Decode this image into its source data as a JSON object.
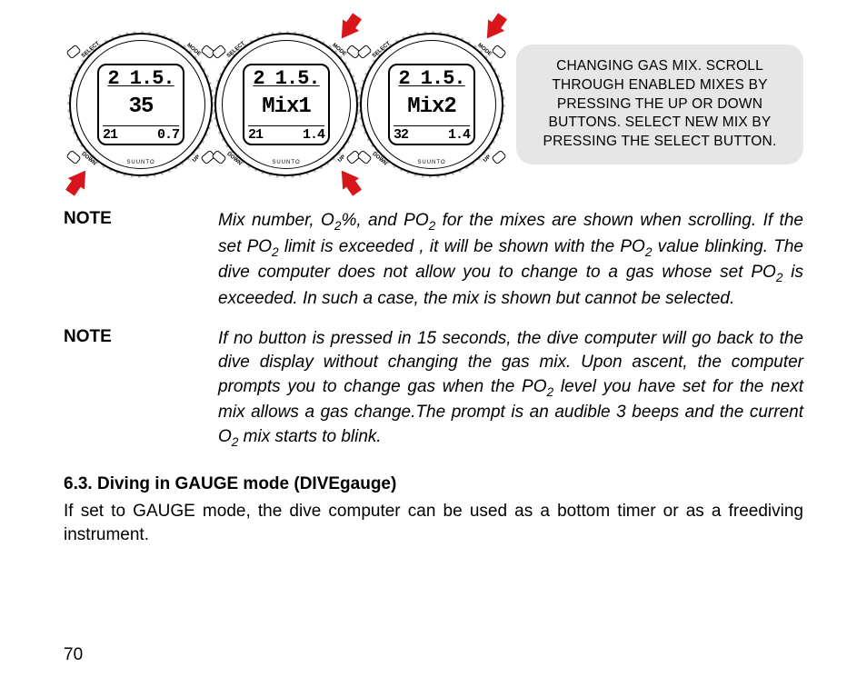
{
  "figure": {
    "watches": [
      {
        "line1": "2 1.5.",
        "line2": "35",
        "line3_left": "21",
        "line3_right": "0.7"
      },
      {
        "line1": "2 1.5.",
        "line2": "Mix1",
        "line3_left": "21",
        "line3_right": "1.4"
      },
      {
        "line1": "2 1.5.",
        "line2": "Mix2",
        "line3_left": "32",
        "line3_right": "1.4"
      }
    ],
    "button_labels": {
      "select": "SELECT",
      "mode": "MODE",
      "down": "DOWN",
      "up": "UP"
    },
    "brand": "SUUNTO",
    "callout": "CHANGING GAS MIX. SCROLL THROUGH ENABLED MIXES BY PRESSING THE UP OR DOWN BUTTONS. SELECT NEW MIX BY PRESSING THE SELECT BUTTON."
  },
  "notes": [
    {
      "label": "NOTE",
      "body_html": "Mix number, O<sub>2</sub>%, and PO<sub>2</sub> for the mixes are shown when scrolling. If the set PO<sub>2</sub> limit is exceeded , it will be shown with the PO<sub>2</sub> value blinking. The dive computer does not allow you to change to a gas whose set PO<sub>2</sub> is exceeded. In such a case, the mix is shown but cannot be selected."
    },
    {
      "label": "NOTE",
      "body_html": "If no button is pressed in 15 seconds, the dive computer will go back to the dive display without changing the gas mix. Upon ascent, the computer prompts you to change gas when the PO<sub>2</sub> level you have set for the next mix allows a gas change.The prompt is an audible 3 beeps and the current O<sub>2</sub> mix starts to blink."
    }
  ],
  "section": {
    "heading": "6.3. Diving in GAUGE mode (DIVEgauge)",
    "body": "If set to GAUGE mode, the dive computer can be used as a bottom timer or as a freediving instrument."
  },
  "page_number": "70"
}
